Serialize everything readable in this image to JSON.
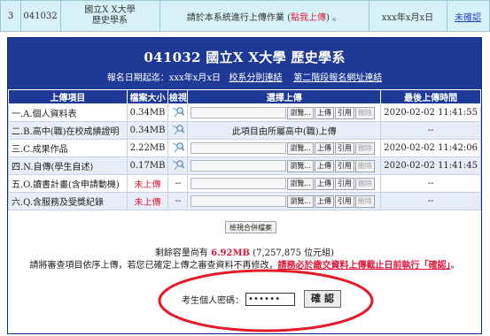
{
  "top_row": {
    "index": "3",
    "code": "041032",
    "dept_line1": "國立X X大學",
    "dept_line2": "歷史學系",
    "message_prefix": "請於本系統進行上傳作業 (",
    "message_link": "點我上傳",
    "message_suffix": ") 。",
    "date": "xxx年x月x日",
    "status": "未確認"
  },
  "banner": {
    "title": "041032 國立X X大學 歷史學系",
    "period_label": "報名日期起迄：xxx年x月x日",
    "link_school": "校系分則連結",
    "link_stage2": "第二階段報名網址連結"
  },
  "table": {
    "headers": [
      "上傳項目",
      "檔案大小",
      "檢視",
      "選擇上傳",
      "最後上傳時間"
    ],
    "rows": [
      {
        "item": "一.A.個人資料表",
        "size": "0.34MB",
        "size_red": false,
        "view": "icon",
        "mode": "upload",
        "time": "2020-02-02 11:41:55"
      },
      {
        "item": "二.B.高中(職)在校成績證明",
        "size": "0.34MB",
        "size_red": false,
        "view": "icon",
        "mode": "note",
        "note": "此項目由所屬高中(職)上傳",
        "time": "--"
      },
      {
        "item": "三.C.成果作品",
        "size": "2.22MB",
        "size_red": false,
        "view": "icon",
        "mode": "upload",
        "time": "2020-02-02 11:42:06"
      },
      {
        "item": "四.N.自傳(學生自述)",
        "size": "0.17MB",
        "size_red": false,
        "view": "icon",
        "mode": "upload",
        "time": "2020-02-02 11:41:45"
      },
      {
        "item": "五.O.讀書計畫(含申請動機)",
        "size": "未上傳",
        "size_red": true,
        "view": "--",
        "mode": "upload",
        "time": "--"
      },
      {
        "item": "六.Q.含服務及受獎紀錄",
        "size": "未上傳",
        "size_red": true,
        "view": "--",
        "mode": "upload",
        "time": "--"
      }
    ],
    "btn_browse": "瀏覽...",
    "btn_upload": "上傳",
    "btn_cite": "引用",
    "btn_delete": "刪除"
  },
  "merge_button": "檢視合併檔案",
  "capacity": {
    "prefix": "剩餘容量尚有 ",
    "value": "6.92MB",
    "suffix": " (7,257,875 位元組)"
  },
  "notice": {
    "text": "請將審查項目依序上傳，若您已確定上傳之審查資料不再修改，",
    "warning": "請務必於繳交資料上傳截止日前執行「確認」",
    "end": "。"
  },
  "password": {
    "label": "考生個人密碼：",
    "value": "••••••",
    "confirm_label": "確 認"
  },
  "colors": {
    "banner": "#1e3996",
    "red": "#e0193a",
    "top_bg": "#d7f1f8",
    "highlight_oval": "#e51b2b"
  }
}
